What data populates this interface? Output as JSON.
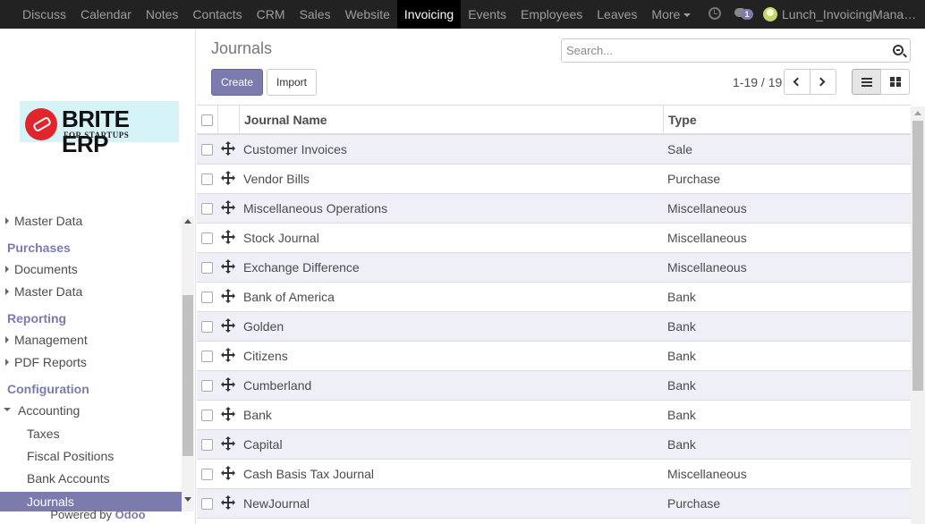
{
  "topbar": {
    "menu": [
      {
        "label": "Discuss",
        "active": false
      },
      {
        "label": "Calendar",
        "active": false
      },
      {
        "label": "Notes",
        "active": false
      },
      {
        "label": "Contacts",
        "active": false
      },
      {
        "label": "CRM",
        "active": false
      },
      {
        "label": "Sales",
        "active": false
      },
      {
        "label": "Website",
        "active": false
      },
      {
        "label": "Invoicing",
        "active": true
      },
      {
        "label": "Events",
        "active": false
      },
      {
        "label": "Employees",
        "active": false
      },
      {
        "label": "Leaves",
        "active": false
      },
      {
        "label": "More",
        "active": false
      }
    ],
    "chat_badge": "1",
    "username": "Lunch_InvoicingManag..."
  },
  "sidebar": {
    "logo_brand": "BRITE ERP",
    "logo_tagline": "FOR STARTUPS",
    "sections": {
      "master_data_top": "Master Data",
      "purchases": "Purchases",
      "documents": "Documents",
      "master_data": "Master Data",
      "reporting": "Reporting",
      "management": "Management",
      "pdf_reports": "PDF Reports",
      "configuration": "Configuration",
      "accounting": "Accounting",
      "taxes": "Taxes",
      "fiscal_positions": "Fiscal Positions",
      "bank_accounts": "Bank Accounts",
      "journals": "Journals"
    },
    "powered_by": "Powered by",
    "powered_brand": "Odoo"
  },
  "control_panel": {
    "title": "Journals",
    "search_placeholder": "Search...",
    "create_label": "Create",
    "import_label": "Import",
    "pager": "1-19 / 19"
  },
  "table": {
    "columns": [
      "Journal Name",
      "Type"
    ],
    "rows": [
      {
        "name": "Customer Invoices",
        "type": "Sale"
      },
      {
        "name": "Vendor Bills",
        "type": "Purchase"
      },
      {
        "name": "Miscellaneous Operations",
        "type": "Miscellaneous"
      },
      {
        "name": "Stock Journal",
        "type": "Miscellaneous"
      },
      {
        "name": "Exchange Difference",
        "type": "Miscellaneous"
      },
      {
        "name": "Bank of America",
        "type": "Bank"
      },
      {
        "name": "Golden",
        "type": "Bank"
      },
      {
        "name": "Citizens",
        "type": "Bank"
      },
      {
        "name": "Cumberland",
        "type": "Bank"
      },
      {
        "name": "Bank",
        "type": "Bank"
      },
      {
        "name": "Capital",
        "type": "Bank"
      },
      {
        "name": "Cash Basis Tax Journal",
        "type": "Miscellaneous"
      },
      {
        "name": "NewJournal",
        "type": "Purchase"
      }
    ]
  },
  "colors": {
    "accent": "#7c7bad",
    "topbar_bg": "#222222",
    "row_alt": "#efeff8"
  }
}
